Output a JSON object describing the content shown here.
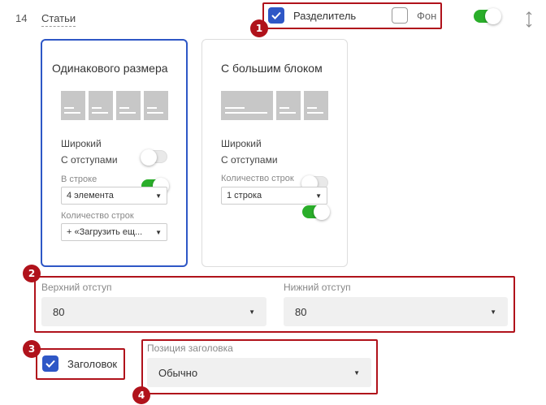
{
  "section": {
    "number": "14",
    "title": "Статьи"
  },
  "top_options": {
    "divider_label": "Разделитель",
    "divider_checked": true,
    "background_label": "Фон",
    "background_checked": false,
    "enabled": true
  },
  "cards": [
    {
      "title": "Одинакового размера",
      "selected": true,
      "wide_label": "Широкий",
      "wide_on": false,
      "padding_label": "С отступами",
      "padding_on": true,
      "per_row_label": "В строке",
      "per_row_value": "4 элемента",
      "rows_label": "Количество строк",
      "rows_value": "+ «Загрузить ещ..."
    },
    {
      "title": "С большим блоком",
      "selected": false,
      "wide_label": "Широкий",
      "wide_on": false,
      "padding_label": "С отступами",
      "padding_on": true,
      "rows_label": "Количество строк",
      "rows_value": "1 строка"
    }
  ],
  "spacing": {
    "top_label": "Верхний отступ",
    "top_value": "80",
    "bottom_label": "Нижний отступ",
    "bottom_value": "80"
  },
  "heading": {
    "label": "Заголовок",
    "checked": true,
    "position_label": "Позиция заголовка",
    "position_value": "Обычно"
  },
  "badges": [
    "1",
    "2",
    "3",
    "4"
  ],
  "colors": {
    "accent": "#2e57c6",
    "highlight": "#b0121b",
    "toggle_on": "#2aae2a"
  },
  "icons": {
    "check": "check-icon",
    "caret": "caret-down-icon",
    "drag": "drag-handle-icon"
  }
}
